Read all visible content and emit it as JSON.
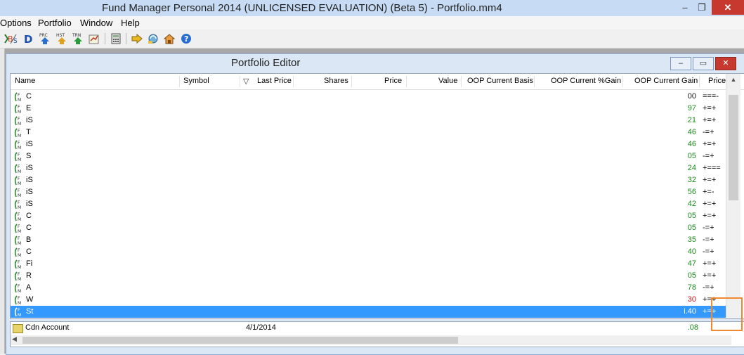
{
  "window": {
    "title": "Fund Manager Personal 2014 (UNLICENSED EVALUATION) (Beta 5) - Portfolio.mm4",
    "min_label": "–",
    "max_label": "❐",
    "close_label": "✕"
  },
  "menu": {
    "items": [
      "Options",
      "Portfolio",
      "Window",
      "Help"
    ]
  },
  "toolbar": {
    "icons": [
      "bs-icon",
      "d-icon",
      "prc-icon",
      "hst-icon",
      "trn-icon",
      "report-icon",
      "calculator-icon",
      "import-icon",
      "refresh-icon",
      "home-icon",
      "help-icon"
    ]
  },
  "editor": {
    "title": "Portfolio Editor",
    "min_label": "–",
    "max_label": "▭",
    "close_label": "✕"
  },
  "columns": [
    "Name",
    "Symbol",
    "Last Price",
    "Shares",
    "Price",
    "Value",
    "OOP Current Basis",
    "OOP Current %Gain",
    "OOP Current Gain",
    "Price"
  ],
  "sort_indicator": "▽",
  "rows": [
    {
      "name": "C",
      "gain": "00",
      "gain_color": "#111111",
      "trend": "===-"
    },
    {
      "name": "E",
      "gain": "97",
      "gain_color": "#1a8a1a",
      "trend": "+=+"
    },
    {
      "name": "iS",
      "gain": "21",
      "gain_color": "#1a8a1a",
      "trend": "+=+"
    },
    {
      "name": "T",
      "gain": "46",
      "gain_color": "#1a8a1a",
      "trend": "-=+"
    },
    {
      "name": "iS",
      "gain": "46",
      "gain_color": "#1a8a1a",
      "trend": "+=+"
    },
    {
      "name": "S",
      "gain": "05",
      "gain_color": "#1a8a1a",
      "trend": "-=+"
    },
    {
      "name": "iS",
      "gain": "24",
      "gain_color": "#1a8a1a",
      "trend": "+==="
    },
    {
      "name": "iS",
      "gain": "32",
      "gain_color": "#1a8a1a",
      "trend": "+=+"
    },
    {
      "name": "iS",
      "gain": "56",
      "gain_color": "#1a8a1a",
      "trend": "+=-"
    },
    {
      "name": "iS",
      "gain": "42",
      "gain_color": "#1a8a1a",
      "trend": "+=+"
    },
    {
      "name": "C",
      "gain": "05",
      "gain_color": "#1a8a1a",
      "trend": "+=+"
    },
    {
      "name": "C",
      "gain": "05",
      "gain_color": "#1a8a1a",
      "trend": "-=+"
    },
    {
      "name": "B",
      "gain": "35",
      "gain_color": "#1a8a1a",
      "trend": "-=+"
    },
    {
      "name": "C",
      "gain": "40",
      "gain_color": "#1a8a1a",
      "trend": "-=+"
    },
    {
      "name": "Fi",
      "gain": "47",
      "gain_color": "#1a8a1a",
      "trend": "+=+"
    },
    {
      "name": "R",
      "gain": "05",
      "gain_color": "#1a8a1a",
      "trend": "+=+"
    },
    {
      "name": "A",
      "gain": "78",
      "gain_color": "#1a8a1a",
      "trend": "-=+"
    },
    {
      "name": "W",
      "gain": "30",
      "gain_color": "#d01010",
      "trend": "+=+"
    },
    {
      "name": "St",
      "gain": "i.40",
      "gain_color": "#ffffff",
      "trend": "+=+",
      "selected": true
    }
  ],
  "account": {
    "name": "Cdn Account",
    "date": "4/1/2014",
    "gain": ".08"
  },
  "scroll_up": "▲",
  "scroll_left": "◀"
}
